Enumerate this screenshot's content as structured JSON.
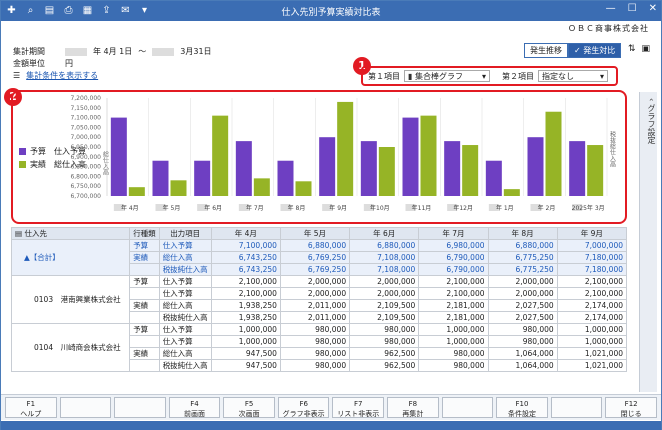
{
  "window": {
    "title": "仕入先別予算実績対比表"
  },
  "company": "ＯＢＣ商事株式会社",
  "period": {
    "label": "集計期間",
    "start": "年 4月 1日",
    "sep": "～",
    "end": "3月31日",
    "unit_label": "金額単位",
    "unit": "円",
    "show_link": "集計条件を表示する"
  },
  "mode": {
    "a": "発生推移",
    "b": "✓ 発生対比"
  },
  "items": {
    "item1_label": "第１項目",
    "item1_value": "集合棒グラフ",
    "item2_label": "第２項目",
    "item2_value": "指定なし"
  },
  "badges": {
    "one": "1",
    "two": "2"
  },
  "side_panel": "グラフ設定",
  "legend": {
    "s1": "予算　仕入予算",
    "s2": "実績　総仕入高"
  },
  "colors": {
    "budget": "#6e3fc2",
    "actual": "#96b426"
  },
  "chart_data": {
    "type": "bar",
    "categories": [
      "年 4月",
      "年 5月",
      "年 6月",
      "年 7月",
      "年 8月",
      "年 9月",
      "年10月",
      "年11月",
      "年12月",
      "年 1月",
      "年 2月",
      "2025年 3月"
    ],
    "series": [
      {
        "name": "予算",
        "values": [
          7100000,
          6880000,
          6880000,
          6980000,
          6880000,
          7000000,
          6980000,
          7100000,
          6980000,
          6880000,
          7000000,
          6980000
        ]
      },
      {
        "name": "実績",
        "values": [
          6745000,
          6780000,
          7110000,
          6790000,
          6775000,
          7180000,
          6950000,
          7110000,
          6960000,
          6735000,
          7130000,
          6960000
        ]
      }
    ],
    "ylim": [
      6700000,
      7200000
    ],
    "yticks": [
      "7,200,000",
      "7,150,000",
      "7,100,000",
      "7,050,000",
      "7,000,000",
      "6,950,000",
      "6,900,000",
      "6,850,000",
      "6,800,000",
      "6,750,000",
      "6,700,000"
    ],
    "ylabel": "総仕入高",
    "y2label": "税抜総仕入高"
  },
  "grid": {
    "headers": [
      "仕入先",
      "行種類",
      "出力項目",
      "年 4月",
      "年 5月",
      "年 6月",
      "年 7月",
      "年 8月",
      "年 9月"
    ],
    "groups": [
      {
        "name": "▲【合計】",
        "rows": [
          {
            "kind": "予算",
            "item": "仕入予算",
            "vals": [
              "7,100,000",
              "6,880,000",
              "6,880,000",
              "6,980,000",
              "6,880,000",
              "7,000,000"
            ]
          },
          {
            "kind": "実績",
            "item": "総仕入高",
            "vals": [
              "6,743,250",
              "6,769,250",
              "7,108,000",
              "6,790,000",
              "6,775,250",
              "7,180,000"
            ]
          },
          {
            "kind": "",
            "item": "税抜純仕入高",
            "vals": [
              "6,743,250",
              "6,769,250",
              "7,108,000",
              "6,790,000",
              "6,775,250",
              "7,180,000"
            ]
          }
        ]
      },
      {
        "name": "0103　港南興業株式会社",
        "rows": [
          {
            "kind": "予算",
            "item": "仕入予算",
            "vals": [
              "2,100,000",
              "2,000,000",
              "2,000,000",
              "2,100,000",
              "2,000,000",
              "2,100,000"
            ]
          },
          {
            "kind": "",
            "item": "仕入予算",
            "vals": [
              "2,100,000",
              "2,000,000",
              "2,000,000",
              "2,100,000",
              "2,000,000",
              "2,100,000"
            ]
          },
          {
            "kind": "実績",
            "item": "総仕入高",
            "vals": [
              "1,938,250",
              "2,011,000",
              "2,109,500",
              "2,181,000",
              "2,027,500",
              "2,174,000"
            ]
          },
          {
            "kind": "",
            "item": "税抜純仕入高",
            "vals": [
              "1,938,250",
              "2,011,000",
              "2,109,500",
              "2,181,000",
              "2,027,500",
              "2,174,000"
            ]
          }
        ]
      },
      {
        "name": "0104　川崎商会株式会社",
        "rows": [
          {
            "kind": "予算",
            "item": "仕入予算",
            "vals": [
              "1,000,000",
              "980,000",
              "980,000",
              "1,000,000",
              "980,000",
              "1,000,000"
            ]
          },
          {
            "kind": "",
            "item": "仕入予算",
            "vals": [
              "1,000,000",
              "980,000",
              "980,000",
              "1,000,000",
              "980,000",
              "1,000,000"
            ]
          },
          {
            "kind": "実績",
            "item": "総仕入高",
            "vals": [
              "947,500",
              "980,000",
              "962,500",
              "980,000",
              "1,064,000",
              "1,021,000"
            ]
          },
          {
            "kind": "",
            "item": "税抜純仕入高",
            "vals": [
              "947,500",
              "980,000",
              "962,500",
              "980,000",
              "1,064,000",
              "1,021,000"
            ]
          }
        ]
      }
    ]
  },
  "footer": [
    {
      "key": "F1",
      "label": "ヘルプ"
    },
    {
      "key": "",
      "label": ""
    },
    {
      "key": "",
      "label": ""
    },
    {
      "key": "F4",
      "label": "前画面"
    },
    {
      "key": "F5",
      "label": "次画面"
    },
    {
      "key": "F6",
      "label": "グラフ非表示"
    },
    {
      "key": "F7",
      "label": "リスト非表示"
    },
    {
      "key": "F8",
      "label": "再集計"
    },
    {
      "key": "",
      "label": ""
    },
    {
      "key": "F10",
      "label": "条件設定"
    },
    {
      "key": "",
      "label": ""
    },
    {
      "key": "F12",
      "label": "閉じる"
    }
  ]
}
